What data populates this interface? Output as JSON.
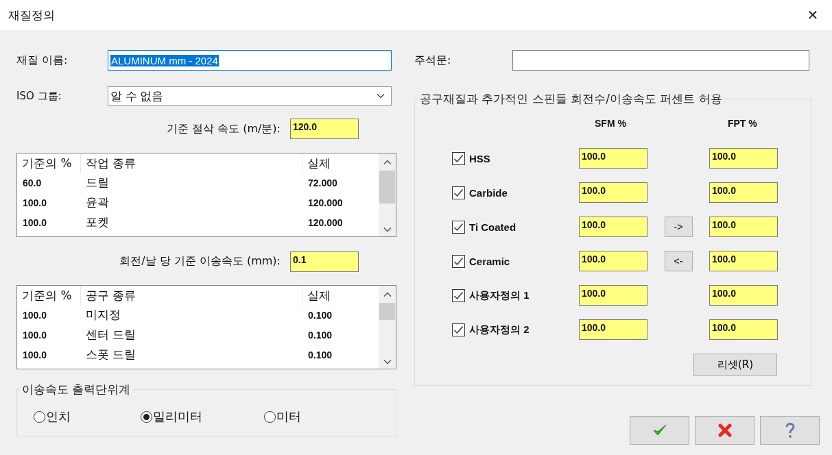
{
  "window": {
    "title": "재질정의",
    "close": "✕"
  },
  "material_name": {
    "label": "재질 이름:",
    "value": "ALUMINUM mm - 2024",
    "selected": true
  },
  "iso_group": {
    "label": "ISO 그룹:",
    "value": "알 수 없음"
  },
  "base_speed": {
    "label": "기준 절삭 속도 (m/분):",
    "value": "120.0"
  },
  "operations_table": {
    "columns": [
      "기준의 %",
      "작업 종류",
      "실제"
    ],
    "rows": [
      {
        "cells": [
          "60.0",
          "드릴",
          "72.000"
        ]
      },
      {
        "cells": [
          "100.0",
          "윤곽",
          "120.000"
        ]
      },
      {
        "cells": [
          "100.0",
          "포켓",
          "120.000"
        ]
      }
    ]
  },
  "base_feed": {
    "label": "회전/날 당 기준 이송속도 (mm):",
    "value": "0.1"
  },
  "tools_table": {
    "columns": [
      "기준의 %",
      "공구 종류",
      "실제"
    ],
    "rows": [
      {
        "cells": [
          "100.0",
          "미지정",
          "0.100"
        ]
      },
      {
        "cells": [
          "100.0",
          "센터 드릴",
          "0.100"
        ]
      },
      {
        "cells": [
          "100.0",
          "스폿 드릴",
          "0.100"
        ]
      }
    ]
  },
  "feed_units": {
    "title": "이송속도 출력단위계",
    "options": [
      {
        "label": "인치",
        "selected": false
      },
      {
        "label": "밀리미터",
        "selected": true
      },
      {
        "label": "미터",
        "selected": false
      }
    ]
  },
  "comment": {
    "label": "주석문:"
  },
  "tool_materials": {
    "title": "공구재질과 추가적인 스핀들 회전수/이송속도 퍼센트 허용",
    "columns": [
      "SFM %",
      "FPT %"
    ],
    "rows": [
      {
        "label": "HSS",
        "checked": true,
        "sfm": "100.0",
        "fpt": "100.0"
      },
      {
        "label": "Carbide",
        "checked": true,
        "sfm": "100.0",
        "fpt": "100.0"
      },
      {
        "label": "Ti Coated",
        "checked": true,
        "sfm": "100.0",
        "fpt": "100.0",
        "arrow_button": "->"
      },
      {
        "label": "Ceramic",
        "checked": true,
        "sfm": "100.0",
        "fpt": "100.0",
        "arrow_button": "<-"
      },
      {
        "label": "사용자정의 1",
        "checked": true,
        "sfm": "100.0",
        "fpt": "100.0"
      },
      {
        "label": "사용자정의 2",
        "checked": true,
        "sfm": "100.0",
        "fpt": "100.0"
      }
    ],
    "reset_button": "리셋(R)"
  },
  "buttons": [
    {
      "kind": "ok"
    },
    {
      "kind": "cancel"
    },
    {
      "kind": "help"
    }
  ]
}
